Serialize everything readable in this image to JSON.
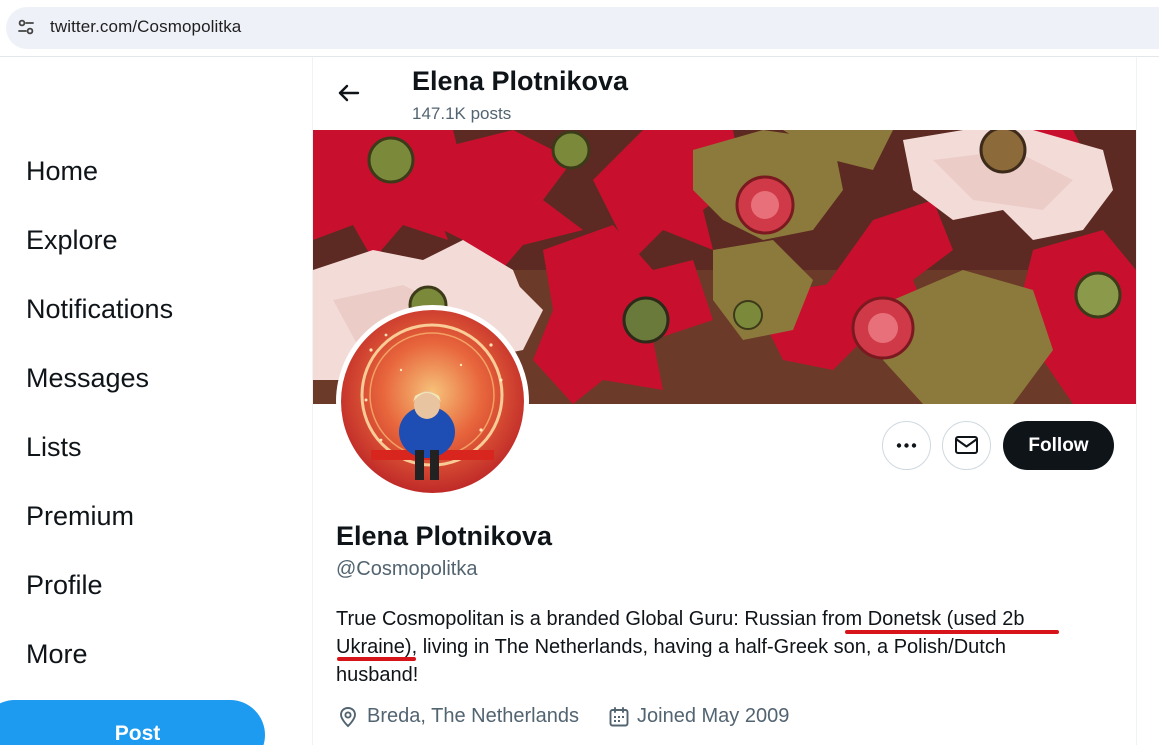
{
  "browser": {
    "url": "twitter.com/Cosmopolitka",
    "site_info_icon": "tune-icon"
  },
  "sidebar": {
    "items": [
      {
        "label": "Home"
      },
      {
        "label": "Explore"
      },
      {
        "label": "Notifications"
      },
      {
        "label": "Messages"
      },
      {
        "label": "Lists"
      },
      {
        "label": "Premium"
      },
      {
        "label": "Profile"
      },
      {
        "label": "More"
      }
    ],
    "post_label": "Post",
    "post_color": "#1d9bf0"
  },
  "header": {
    "name": "Elena Plotnikova",
    "post_count": "147.1K posts",
    "back_icon": "arrow-left-icon"
  },
  "profile": {
    "name": "Elena Plotnikova",
    "handle": "@Cosmopolitka",
    "bio_lines": [
      "True Cosmopolitan is a branded Global Guru: Russian from Donetsk (used 2b",
      "Ukraine), living in The Netherlands, having a half-Greek son, a Polish/Dutch",
      "husband!"
    ],
    "location": "Breda, The Netherlands",
    "joined": "Joined May 2009",
    "follow_label": "Follow",
    "more_icon": "more-dots-icon",
    "message_icon": "envelope-icon",
    "underline_color": "#d8141b"
  }
}
